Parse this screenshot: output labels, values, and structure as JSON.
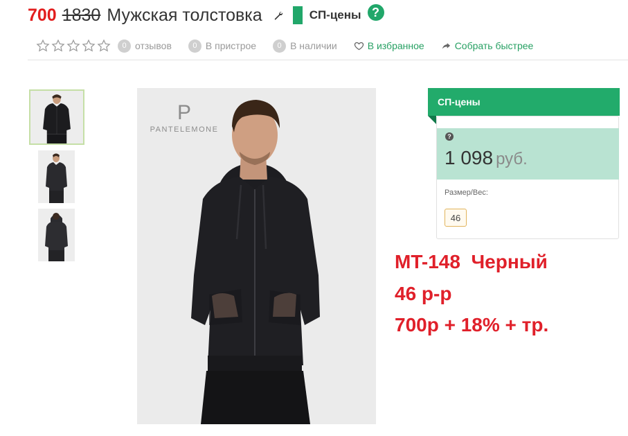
{
  "header": {
    "price_new": "700",
    "price_old": "1830",
    "title": "Мужская толстовка",
    "sp_label": "СП-цены",
    "help_glyph": "?"
  },
  "meta": {
    "rating_stars": 0,
    "reviews_count": "0",
    "reviews_label": "отзывов",
    "pristroy_count": "0",
    "pristroy_label": "В пристрое",
    "stock_count": "0",
    "stock_label": "В наличии",
    "favorite_label": "В избранное",
    "collect_label": "Собрать быстрее"
  },
  "gallery": {
    "brand_mark": "P",
    "brand_name": "PANTELEMONE",
    "thumbnail_count": 3
  },
  "sidebar": {
    "header": "СП-цены",
    "price": "1 098",
    "currency": "руб.",
    "size_label": "Размер/Вес:",
    "sizes": [
      "46"
    ]
  },
  "note": {
    "line1": "MT-148  Черный",
    "line2": "46 р-р",
    "line3": "700р + 18% + тр."
  },
  "colors": {
    "accent_green": "#22ab6b",
    "price_red": "#e21d1d",
    "panel_mint": "#b9e3d2"
  }
}
